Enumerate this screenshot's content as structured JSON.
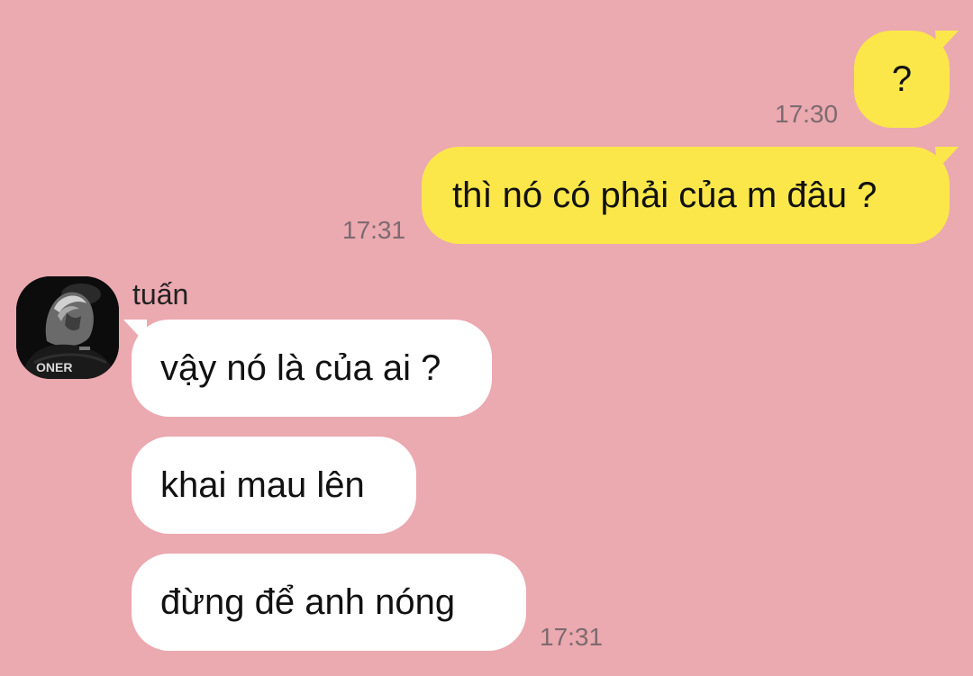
{
  "colors": {
    "background": "#eba9b0",
    "outgoing_bubble": "#fbe74a",
    "incoming_bubble": "#ffffff",
    "timestamp": "#7d6b70"
  },
  "messages": {
    "out_1": {
      "text": "?",
      "time": "17:30"
    },
    "out_2": {
      "text": "thì nó có phải của m đâu ?",
      "time": "17:31"
    },
    "in_group": {
      "sender": "tuấn",
      "avatar_caption": "ONER",
      "msg_1": {
        "text": "vậy nó là của ai ?"
      },
      "msg_2": {
        "text": "khai mau lên"
      },
      "msg_3": {
        "text": "đừng để anh nóng"
      },
      "time": "17:31"
    }
  }
}
